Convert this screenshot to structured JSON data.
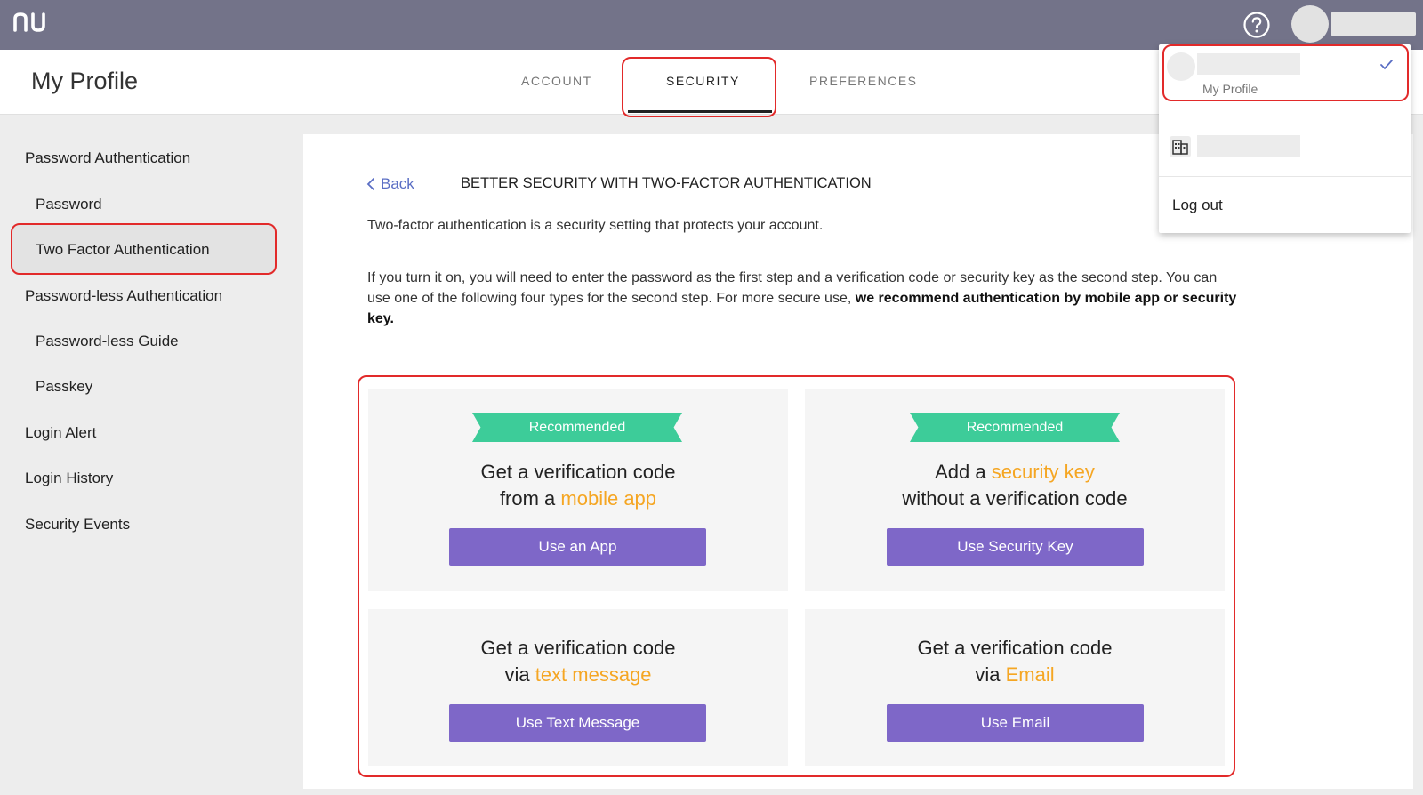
{
  "topbar": {
    "logo_text": "nu",
    "help_icon": "question-circle-icon",
    "colors": {
      "bar": "#737389"
    }
  },
  "header": {
    "page_title": "My Profile",
    "tabs": [
      {
        "label": "ACCOUNT"
      },
      {
        "label": "SECURITY",
        "active": true
      },
      {
        "label": "PREFERENCES"
      }
    ]
  },
  "sidebar": {
    "items": [
      {
        "label": "Password Authentication"
      },
      {
        "label": "Password"
      },
      {
        "label": "Two Factor Authentication",
        "active": true
      },
      {
        "label": "Password-less Authentication"
      },
      {
        "label": "Password-less Guide"
      },
      {
        "label": "Passkey"
      },
      {
        "label": "Login Alert"
      },
      {
        "label": "Login History"
      },
      {
        "label": "Security Events"
      }
    ]
  },
  "main": {
    "back_label": "Back",
    "section_title": "BETTER SECURITY WITH TWO-FACTOR AUTHENTICATION",
    "intro": "Two-factor authentication is a security setting that protects your account.",
    "desc_plain": "If you turn it on, you will need to enter the password as the first step and a verification code or security key as the second step. You can use one of the following four types for the second step. For more secure use, ",
    "desc_bold": "we recommend authentication by mobile app or security key.",
    "options": [
      {
        "badge": "Recommended",
        "line1": "Get a verification code",
        "line2_pre": "from a ",
        "line2_hl": "mobile app",
        "button": "Use an App"
      },
      {
        "badge": "Recommended",
        "line1_pre": "Add a ",
        "line1_hl": "security key",
        "line2": "without a verification code",
        "button": "Use Security Key"
      },
      {
        "line1": "Get a verification code",
        "line2_pre": "via ",
        "line2_hl": "text message",
        "button": "Use Text Message"
      },
      {
        "line1": "Get a verification code",
        "line2_pre": "via ",
        "line2_hl": "Email",
        "button": "Use Email"
      }
    ],
    "colors": {
      "accent_button": "#7e67c8",
      "ribbon": "#3dcc99",
      "highlight": "#f5a623",
      "link": "#5a6ec4"
    }
  },
  "dropdown": {
    "profile_sub": "My Profile",
    "check_icon": "checkmark-icon",
    "org_icon": "building-icon",
    "logout_label": "Log out"
  },
  "annotation_color": "#e22a2a"
}
